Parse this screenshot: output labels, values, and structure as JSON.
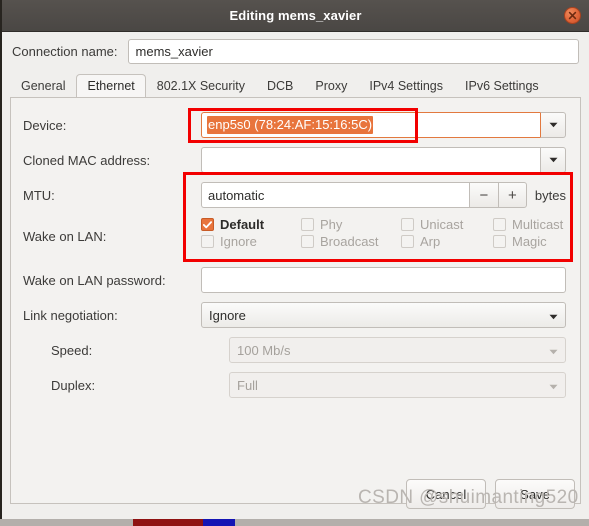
{
  "window": {
    "title": "Editing mems_xavier",
    "close_icon": "close-icon"
  },
  "connection": {
    "label": "Connection name:",
    "value": "mems_xavier"
  },
  "tabs": [
    {
      "label": "General",
      "active": false
    },
    {
      "label": "Ethernet",
      "active": true
    },
    {
      "label": "802.1X Security",
      "active": false
    },
    {
      "label": "DCB",
      "active": false
    },
    {
      "label": "Proxy",
      "active": false
    },
    {
      "label": "IPv4 Settings",
      "active": false
    },
    {
      "label": "IPv6 Settings",
      "active": false
    }
  ],
  "form": {
    "device": {
      "label": "Device:",
      "value": "enp5s0 (78:24:AF:15:16:5C)",
      "selected": true,
      "arrow_icon": "chevron-down-icon"
    },
    "cloned_mac": {
      "label": "Cloned MAC address:",
      "value": "",
      "arrow_icon": "chevron-down-icon"
    },
    "mtu": {
      "label": "MTU:",
      "value": "automatic",
      "decrement_label": "−",
      "increment_label": "+",
      "units": "bytes"
    },
    "wake_on_lan": {
      "label": "Wake on LAN:",
      "options": [
        {
          "label": "Default",
          "checked": true,
          "enabled": true
        },
        {
          "label": "Phy",
          "checked": false,
          "enabled": false
        },
        {
          "label": "Unicast",
          "checked": false,
          "enabled": false
        },
        {
          "label": "Multicast",
          "checked": false,
          "enabled": false
        },
        {
          "label": "Ignore",
          "checked": false,
          "enabled": false
        },
        {
          "label": "Broadcast",
          "checked": false,
          "enabled": false
        },
        {
          "label": "Arp",
          "checked": false,
          "enabled": false
        },
        {
          "label": "Magic",
          "checked": false,
          "enabled": false
        }
      ]
    },
    "wol_password": {
      "label": "Wake on LAN password:",
      "value": ""
    },
    "link_negotiation": {
      "label": "Link negotiation:",
      "value": "Ignore",
      "enabled": true,
      "arrow_icon": "chevron-down-icon"
    },
    "speed": {
      "label": "Speed:",
      "value": "100 Mb/s",
      "enabled": false,
      "arrow_icon": "chevron-down-icon"
    },
    "duplex": {
      "label": "Duplex:",
      "value": "Full",
      "enabled": false,
      "arrow_icon": "chevron-down-icon"
    }
  },
  "actions": {
    "cancel": "Cancel",
    "save": "Save"
  },
  "watermark": "CSDN @shuimanting520",
  "colors": {
    "accent": "#e8743c",
    "annotation": "#f20000",
    "titlebar": "#4d4a47",
    "panel": "#f3f2f0"
  }
}
